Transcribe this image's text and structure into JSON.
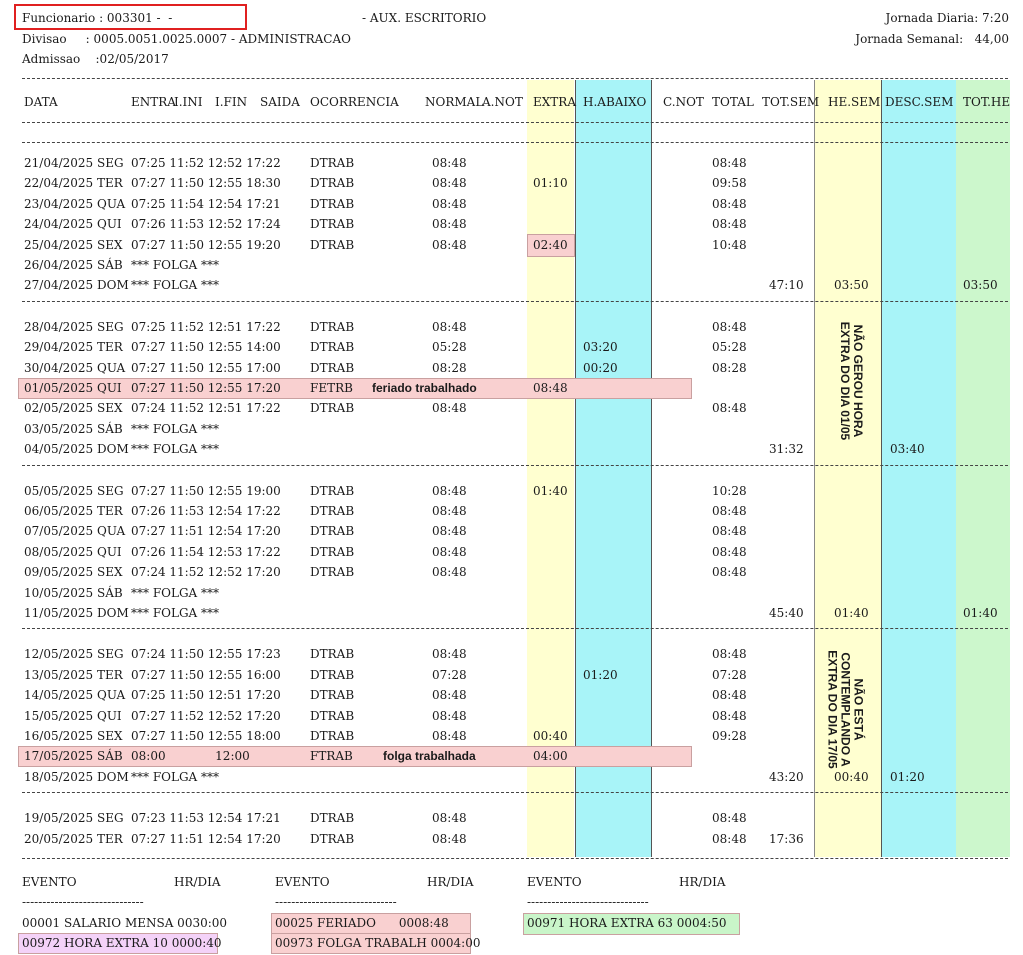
{
  "header": {
    "employee": "Funcionario : 003301 -  -",
    "role": "- AUX. ESCRITORIO",
    "division": "Divisao     : 0005.0051.0025.0007 - ADMINISTRACAO",
    "admission": "Admissao    :02/05/2017",
    "daily": "Jornada Diaria: 7:20",
    "weekly": "Jornada Semanal:   44,00"
  },
  "columns": [
    "DATA",
    "ENTRA",
    "I.INI",
    "I.FIN",
    "SAIDA",
    "OCORRENCIA",
    "NORMAL",
    "A.NOT",
    "EXTRA",
    "H.ABAIXO",
    "C.NOT",
    "TOTAL",
    "TOT.SEM",
    "HE.SEM",
    "DESC.SEM",
    "TOT.HE"
  ],
  "weeks": [
    {
      "rows": [
        {
          "date": "21/04/2025 SEG",
          "t": "07:25 11:52 12:52 17:22",
          "oc": "DTRAB",
          "normal": "08:48",
          "total": "08:48"
        },
        {
          "date": "22/04/2025 TER",
          "t": "07:27 11:50 12:55 18:30",
          "oc": "DTRAB",
          "normal": "08:48",
          "extra": "01:10",
          "total": "09:58"
        },
        {
          "date": "23/04/2025 QUA",
          "t": "07:25 11:54 12:54 17:21",
          "oc": "DTRAB",
          "normal": "08:48",
          "total": "08:48"
        },
        {
          "date": "24/04/2025 QUI",
          "t": "07:26 11:53 12:52 17:24",
          "oc": "DTRAB",
          "normal": "08:48",
          "total": "08:48"
        },
        {
          "date": "25/04/2025 SEX",
          "t": "07:27 11:50 12:55 19:20",
          "oc": "DTRAB",
          "normal": "08:48",
          "extra": "02:40",
          "total": "10:48",
          "extra_hl": "pink"
        },
        {
          "date": "26/04/2025 SÁB",
          "t": "*** FOLGA ***"
        },
        {
          "date": "27/04/2025 DOM",
          "t": "*** FOLGA ***",
          "totsem": "47:10",
          "hesem": "03:50",
          "tothe": "03:50"
        }
      ]
    },
    {
      "rows": [
        {
          "date": "28/04/2025 SEG",
          "t": "07:25 11:52 12:51 17:22",
          "oc": "DTRAB",
          "normal": "08:48",
          "total": "08:48"
        },
        {
          "date": "29/04/2025 TER",
          "t": "07:27 11:50 12:55 14:00",
          "oc": "DTRAB",
          "normal": "05:28",
          "habaixo": "03:20",
          "total": "05:28"
        },
        {
          "date": "30/04/2025 QUA",
          "t": "07:27 11:50 12:55 17:00",
          "oc": "DTRAB",
          "normal": "08:28",
          "habaixo": "00:20",
          "total": "08:28"
        },
        {
          "date": "01/05/2025 QUI",
          "t": "07:27 11:50 12:55 17:20",
          "oc": "FETRB",
          "note": "feriado trabalhado",
          "extra": "08:48",
          "row_hl": "pink"
        },
        {
          "date": "02/05/2025 SEX",
          "t": "07:24 11:52 12:51 17:22",
          "oc": "DTRAB",
          "normal": "08:48",
          "total": "08:48"
        },
        {
          "date": "03/05/2025 SÁB",
          "t": "*** FOLGA ***"
        },
        {
          "date": "04/05/2025 DOM",
          "t": "*** FOLGA ***",
          "totsem": "31:32",
          "descsem": "03:40"
        }
      ],
      "side_note": "NÃO GEROU HORA EXTRA DO DIA 01/05"
    },
    {
      "rows": [
        {
          "date": "05/05/2025 SEG",
          "t": "07:27 11:50 12:55 19:00",
          "oc": "DTRAB",
          "normal": "08:48",
          "extra": "01:40",
          "total": "10:28"
        },
        {
          "date": "06/05/2025 TER",
          "t": "07:26 11:53 12:54 17:22",
          "oc": "DTRAB",
          "normal": "08:48",
          "total": "08:48"
        },
        {
          "date": "07/05/2025 QUA",
          "t": "07:27 11:51 12:54 17:20",
          "oc": "DTRAB",
          "normal": "08:48",
          "total": "08:48"
        },
        {
          "date": "08/05/2025 QUI",
          "t": "07:26 11:54 12:53 17:22",
          "oc": "DTRAB",
          "normal": "08:48",
          "total": "08:48"
        },
        {
          "date": "09/05/2025 SEX",
          "t": "07:24 11:52 12:52 17:20",
          "oc": "DTRAB",
          "normal": "08:48",
          "total": "08:48"
        },
        {
          "date": "10/05/2025 SÁB",
          "t": "*** FOLGA ***"
        },
        {
          "date": "11/05/2025 DOM",
          "t": "*** FOLGA ***",
          "totsem": "45:40",
          "hesem": "01:40",
          "tothe": "01:40"
        }
      ]
    },
    {
      "rows": [
        {
          "date": "12/05/2025 SEG",
          "t": "07:24 11:50 12:55 17:23",
          "oc": "DTRAB",
          "normal": "08:48",
          "total": "08:48"
        },
        {
          "date": "13/05/2025 TER",
          "t": "07:27 11:50 12:55 16:00",
          "oc": "DTRAB",
          "normal": "07:28",
          "habaixo": "01:20",
          "total": "07:28"
        },
        {
          "date": "14/05/2025 QUA",
          "t": "07:25 11:50 12:51 17:20",
          "oc": "DTRAB",
          "normal": "08:48",
          "total": "08:48"
        },
        {
          "date": "15/05/2025 QUI",
          "t": "07:27 11:52 12:52 17:20",
          "oc": "DTRAB",
          "normal": "08:48",
          "total": "08:48"
        },
        {
          "date": "16/05/2025 SEX",
          "t": "07:27 11:50 12:55 18:00",
          "oc": "DTRAB",
          "normal": "08:48",
          "extra": "00:40",
          "total": "09:28"
        },
        {
          "date": "17/05/2025 SÁB",
          "t": "08:00             12:00",
          "oc": "FTRAB",
          "note": "folga trabalhada",
          "extra": "04:00",
          "row_hl": "pink"
        },
        {
          "date": "18/05/2025 DOM",
          "t": "*** FOLGA ***",
          "totsem": "43:20",
          "hesem": "00:40",
          "descsem": "01:20"
        }
      ],
      "side_note": "NÃO ESTÁ CONTEMPLANDO A EXTRA DO DIA 17/05"
    },
    {
      "rows": [
        {
          "date": "19/05/2025 SEG",
          "t": "07:23 11:53 12:54 17:21",
          "oc": "DTRAB",
          "normal": "08:48",
          "total": "08:48"
        },
        {
          "date": "20/05/2025 TER",
          "t": "07:27 11:51 12:54 17:20",
          "oc": "DTRAB",
          "normal": "08:48",
          "total": "08:48",
          "totsem": "17:36"
        }
      ]
    }
  ],
  "events": {
    "headers": [
      "EVENTO",
      "HR/DIA"
    ],
    "col1": [
      "00001 SALARIO MENSA 0030:00",
      "00972 HORA EXTRA 10 0000:40"
    ],
    "col2": [
      "00025 FERIADO      0008:48",
      "00973 FOLGA TRABALH 0004:00"
    ],
    "col3": [
      "00971 HORA EXTRA 63 0004:50"
    ]
  },
  "colors": {
    "extra": "#ffffcc",
    "habaixo": "#aaf6fa",
    "hesem": "#ffffcc",
    "descsem": "#aaf6fa",
    "tothe": "#ccf7cc",
    "pink": "#f9d0d0",
    "violet": "#f4d2f8",
    "green": "#c9f5c9"
  }
}
